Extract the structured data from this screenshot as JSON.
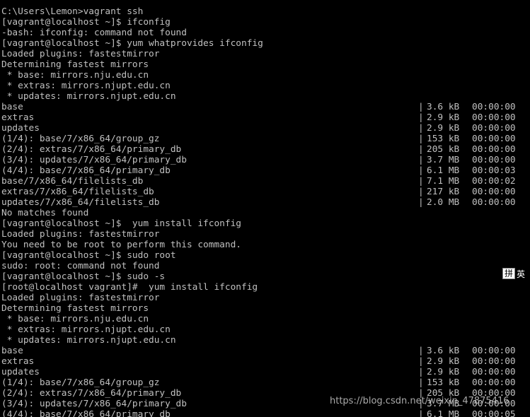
{
  "terminal": {
    "text_color": "#c0c0c0",
    "background": "#000000",
    "lines": [
      {
        "text": "C:\\Users\\Lemon>vagrant ssh"
      },
      {
        "text": "[vagrant@localhost ~]$ ifconfig"
      },
      {
        "text": "-bash: ifconfig: command not found"
      },
      {
        "text": "[vagrant@localhost ~]$ yum whatprovides ifconfig"
      },
      {
        "text": "Loaded plugins: fastestmirror"
      },
      {
        "text": "Determining fastest mirrors"
      },
      {
        "text": " * base: mirrors.nju.edu.cn"
      },
      {
        "text": " * extras: mirrors.njupt.edu.cn"
      },
      {
        "text": " * updates: mirrors.njupt.edu.cn"
      },
      {
        "text": "base",
        "sep": "|",
        "size": "3.6 kB",
        "time": "00:00:00"
      },
      {
        "text": "extras",
        "sep": "|",
        "size": "2.9 kB",
        "time": "00:00:00"
      },
      {
        "text": "updates",
        "sep": "|",
        "size": "2.9 kB",
        "time": "00:00:00"
      },
      {
        "text": "(1/4): base/7/x86_64/group_gz",
        "sep": "|",
        "size": "153 kB",
        "time": "00:00:00"
      },
      {
        "text": "(2/4): extras/7/x86_64/primary_db",
        "sep": "|",
        "size": "205 kB",
        "time": "00:00:00"
      },
      {
        "text": "(3/4): updates/7/x86_64/primary_db",
        "sep": "|",
        "size": "3.7 MB",
        "time": "00:00:00"
      },
      {
        "text": "(4/4): base/7/x86_64/primary_db",
        "sep": "|",
        "size": "6.1 MB",
        "time": "00:00:03"
      },
      {
        "text": "base/7/x86_64/filelists_db",
        "sep": "|",
        "size": "7.1 MB",
        "time": "00:00:02"
      },
      {
        "text": "extras/7/x86_64/filelists_db",
        "sep": "|",
        "size": "217 kB",
        "time": "00:00:00"
      },
      {
        "text": "updates/7/x86_64/filelists_db",
        "sep": "|",
        "size": "2.0 MB",
        "time": "00:00:00"
      },
      {
        "text": "No matches found"
      },
      {
        "text": "[vagrant@localhost ~]$  yum install ifconfig"
      },
      {
        "text": "Loaded plugins: fastestmirror"
      },
      {
        "text": "You need to be root to perform this command."
      },
      {
        "text": "[vagrant@localhost ~]$ sudo root"
      },
      {
        "text": "sudo: root: command not found"
      },
      {
        "text": "[vagrant@localhost ~]$ sudo -s"
      },
      {
        "text": "[root@localhost vagrant]#  yum install ifconfig"
      },
      {
        "text": "Loaded plugins: fastestmirror"
      },
      {
        "text": "Determining fastest mirrors"
      },
      {
        "text": " * base: mirrors.nju.edu.cn"
      },
      {
        "text": " * extras: mirrors.njupt.edu.cn"
      },
      {
        "text": " * updates: mirrors.njupt.edu.cn"
      },
      {
        "text": "base",
        "sep": "|",
        "size": "3.6 kB",
        "time": "00:00:00"
      },
      {
        "text": "extras",
        "sep": "|",
        "size": "2.9 kB",
        "time": "00:00:00"
      },
      {
        "text": "updates",
        "sep": "|",
        "size": "2.9 kB",
        "time": "00:00:00"
      },
      {
        "text": "(1/4): base/7/x86_64/group_gz",
        "sep": "|",
        "size": "153 kB",
        "time": "00:00:00"
      },
      {
        "text": "(2/4): extras/7/x86_64/primary_db",
        "sep": "|",
        "size": "205 kB",
        "time": "00:00:00"
      },
      {
        "text": "(3/4): updates/7/x86_64/primary_db",
        "sep": "|",
        "size": "3.7 MB",
        "time": "00:00:00"
      },
      {
        "text": "(4/4): base/7/x86_64/primary_db",
        "sep": "|",
        "size": "6.1 MB",
        "time": "00:00:05"
      }
    ]
  },
  "ime": {
    "label": "拼",
    "trailing": "英"
  },
  "watermark": {
    "text": "https://blog.csdn.net/weixin_47875416"
  }
}
